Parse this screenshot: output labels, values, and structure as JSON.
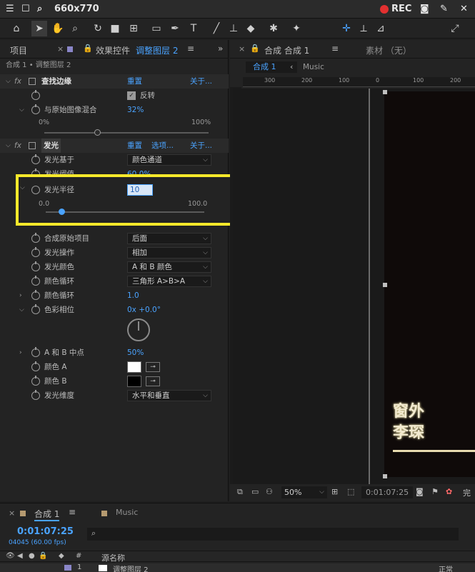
{
  "capture_bar": {
    "size_label": "660x770",
    "rec_label": "REC"
  },
  "toolbar": {
    "snap_label": "对齐"
  },
  "left_tabs": {
    "project": "项目",
    "effects": "效果控件",
    "layer": "调整图层 2"
  },
  "left_header": "合成 1 • 调整图层 2",
  "effect1": {
    "name": "查找边缘",
    "reset": "重置",
    "about": "关于...",
    "invert_label": "反转",
    "blend_label": "与原始图像混合",
    "blend_value": "32%",
    "blend_min": "0%",
    "blend_max": "100%",
    "blend_fraction": 0.32
  },
  "effect2": {
    "name": "发光",
    "reset": "重置",
    "options": "选项...",
    "about": "关于...",
    "glow_based_label": "发光基于",
    "glow_based_value": "颜色通道",
    "hidden_label": "发光阈值",
    "hidden_value": "60.0%",
    "radius_label": "发光半径",
    "radius_value": "10",
    "radius_min": "0.0",
    "radius_max": "100.0",
    "radius_fraction": 0.1,
    "composite_label": "合成原始项目",
    "composite_value": "后面",
    "operation_label": "发光操作",
    "operation_value": "相加",
    "colors_label": "发光颜色",
    "colors_value": "A 和 B 颜色",
    "loop_label": "颜色循环",
    "loop_value": "三角形 A>B>A",
    "cycles_label": "颜色循环",
    "cycles_value": "1.0",
    "phase_label": "色彩相位",
    "phase_value": "0x +0.0°",
    "midpoint_label": "A 和 B 中点",
    "midpoint_value": "50%",
    "colorA_label": "颜色 A",
    "colorA": "#ffffff",
    "colorB_label": "颜色 B",
    "colorB": "#000000",
    "dimensions_label": "发光维度",
    "dimensions_value": "水平和垂直"
  },
  "comp_panel": {
    "tab_comp": "合成 合成 1",
    "tab_footage": "素材 （无）",
    "crumb_comp": "合成 1",
    "crumb_music": "Music",
    "ruler_labels": [
      "300",
      "200",
      "100",
      "0",
      "100",
      "200"
    ],
    "canvas_text_line1": "窗外",
    "canvas_text_line2": "李琛",
    "zoom": "50%",
    "timecode": "0:01:07:25",
    "complete_label": "完"
  },
  "timeline": {
    "tab_comp": "合成 1",
    "tab_music": "Music",
    "time": "0:01:07:25",
    "frames": "04045 (60.00 fps)",
    "search_placeholder": "",
    "col_source": "源名称",
    "row_label": "调整图层 2",
    "row_num": "1",
    "mode_label": "正常"
  },
  "colors": {
    "accent": "#4aa3ff",
    "highlight": "#f7e92b"
  }
}
